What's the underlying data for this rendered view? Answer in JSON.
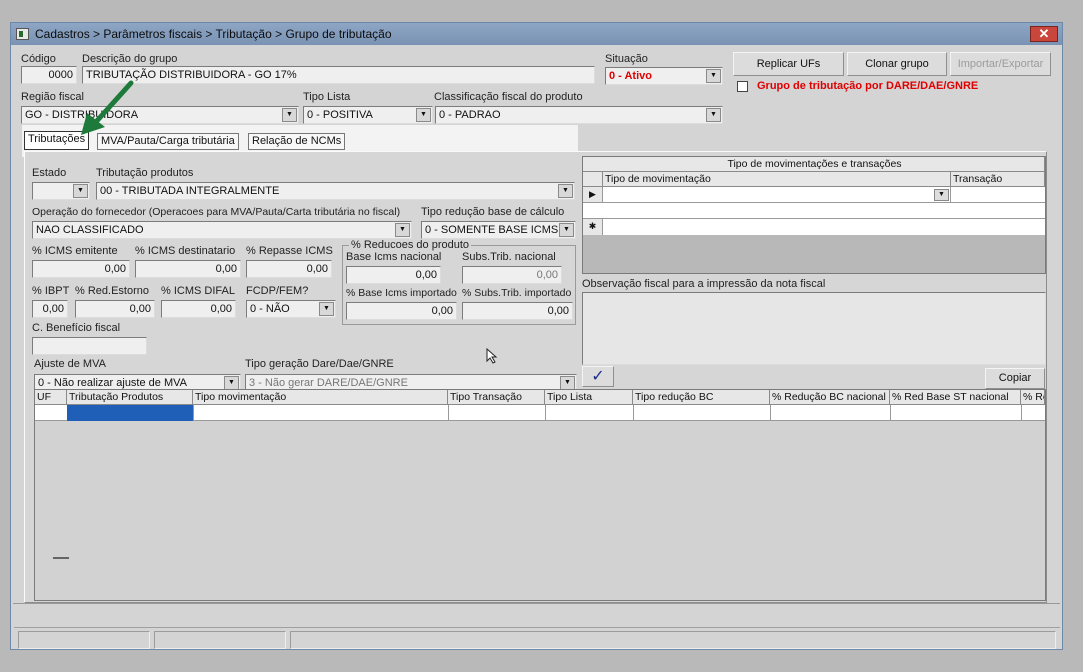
{
  "window": {
    "title": "Cadastros > Parâmetros fiscais > Tributação > Grupo de tributação",
    "close": "✕"
  },
  "header": {
    "codigo_label": "Código",
    "codigo_value": "0000",
    "descricao_label": "Descrição do grupo",
    "descricao_value": "TRIBUTAÇÃO DISTRIBUIDORA - GO 17%",
    "situacao_label": "Situação",
    "situacao_value": "0 - Ativo",
    "replicar_label": "Replicar UFs",
    "clonar_label": "Clonar grupo",
    "importar_label": "Importar/Exportar",
    "dare_label": "Grupo de tributação por DARE/DAE/GNRE",
    "regiao_label": "Região fiscal",
    "regiao_value": "GO - DISTRIBUIDORA",
    "tipolista_label": "Tipo Lista",
    "tipolista_value": "0 - POSITIVA",
    "classificacao_label": "Classificação fiscal do produto",
    "classificacao_value": "0 - PADRAO"
  },
  "tabs": [
    "Tributações",
    "MVA/Pauta/Carga tributária",
    "Relação de NCMs"
  ],
  "form": {
    "estado_label": "Estado",
    "estado_value": "",
    "tribprod_label": "Tributação produtos",
    "tribprod_value": "00 - TRIBUTADA INTEGRALMENTE",
    "operacao_label": "Operação do fornecedor (Operacoes para MVA/Pauta/Carta tributária no fiscal)",
    "operacao_value": "NAO CLASSIFICADO",
    "tiporeducao_label": "Tipo redução base de cálculo",
    "tiporeducao_value": "0 - SOMENTE BASE ICMS",
    "icms_emitente_label": "% ICMS emitente",
    "icms_emitente_value": "0,00",
    "icms_dest_label": "% ICMS destinatario",
    "icms_dest_value": "0,00",
    "repasse_label": "% Repasse ICMS",
    "repasse_value": "0,00",
    "reducoes_label": "% Reducoes do produto",
    "base_nac_label": "Base Icms nacional",
    "base_nac_value": "0,00",
    "subs_nac_label": "Subs.Trib. nacional",
    "subs_nac_value": "0,00",
    "base_imp_label": "% Base Icms importado",
    "base_imp_value": "0,00",
    "subs_imp_label": "% Subs.Trib. importado",
    "subs_imp_value": "0,00",
    "ibpt_label": "% IBPT",
    "ibpt_value": "0,00",
    "redestorno_label": "% Red.Estorno",
    "redestorno_value": "0,00",
    "difal_label": "% ICMS DIFAL",
    "difal_value": "0,00",
    "fcdp_label": "FCDP/FEM?",
    "fcdp_value": "0 - NÃO",
    "beneficio_label": "C. Benefício fiscal",
    "beneficio_value": "",
    "ajuste_label": "Ajuste de MVA",
    "ajuste_value": "0 - Não realizar ajuste de MVA",
    "dare_tipo_label": "Tipo geração Dare/Dae/GNRE",
    "dare_tipo_value": "3 - Não gerar DARE/DAE/GNRE"
  },
  "movgrid": {
    "title": "Tipo de movimentações e transações",
    "col_mov": "Tipo de movimentação",
    "col_trans": "Transação"
  },
  "observacao_label": "Observação fiscal para a impressão da nota fiscal",
  "copiar_label": "Copiar",
  "confirm_glyph": "✓",
  "maingrid": {
    "columns": [
      "UF",
      "Tributação Produtos",
      "Tipo movimentação",
      "Tipo Transação",
      "Tipo Lista",
      "Tipo redução BC",
      "% Redução BC nacional",
      "% Red Base ST nacional",
      "% Re"
    ]
  },
  "colors": {
    "accent_red": "#e00000",
    "arrow_green": "#1d7a3a",
    "selection_blue": "#1f5fb8"
  }
}
